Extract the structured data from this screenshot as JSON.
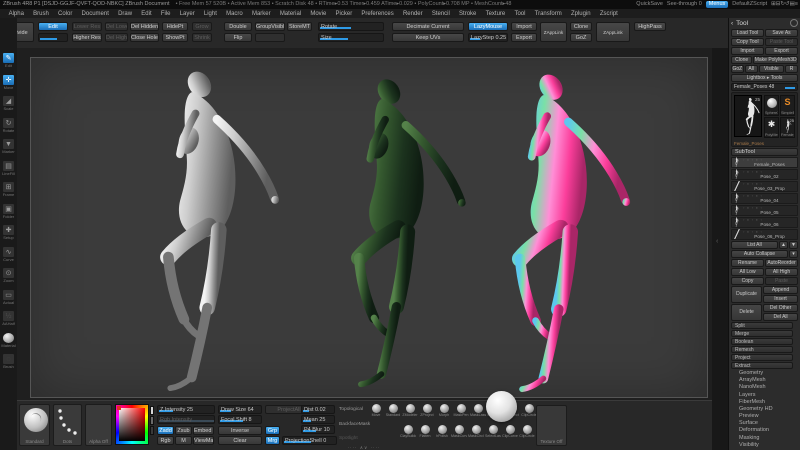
{
  "colors": {
    "accent": "#2e9ae6",
    "canvas_bg": "#3b3b3b",
    "shelf_bg": "#282828",
    "panel_bg": "#2c2c2c",
    "blue_button_top": "#49b0f2",
    "blue_button_bottom": "#1a6db6"
  },
  "titlebar": {
    "title": "ZBrush 4R8 P1 [DSJD-GGJF-QVFT-QOD-NBKC]  ZBrush Document",
    "stats": "• Free Mem 57 520B • Active Mem 853 • Scratch Disk 48 • RTime▸0.53 Timer▸0.459 ATime▸0.029 • PolyCount▸0.708 MP • MeshCount▸48",
    "quicksave": "QuickSave",
    "see_through": "See-through 0",
    "menus": "Menus",
    "zscript": "DefaultZScript",
    "icons": [
      "⊞",
      "⊟",
      "↻",
      "↺",
      "▤",
      "≡"
    ]
  },
  "menubar": {
    "items": [
      "Alpha",
      "Brush",
      "Color",
      "Document",
      "Draw",
      "Edit",
      "File",
      "Layer",
      "Light",
      "Macro",
      "Marker",
      "Material",
      "Movie",
      "Picker",
      "Preferences",
      "Render",
      "Stencil",
      "Stroke",
      "Texture",
      "Tool",
      "Transform",
      "Zplugin",
      "Zscript"
    ]
  },
  "topshelf": {
    "divide": "Divide",
    "edit": "Edit",
    "lower_res": "Lower Res",
    "higher_res": "Higher Res",
    "del_lower": "Del Lower",
    "del_higher": "Del Higher",
    "del_hidden": "Del Hidden",
    "close_holes": "Close Holes",
    "hidept": "HidePt",
    "showpt": "ShowPt",
    "grow": "Grow",
    "shrink": "Shrink",
    "double": "Double",
    "flip": "Flip",
    "group_visible": "GroupVisible",
    "store_mt": "StoreMT",
    "rotate": "Rotate",
    "size": "Size",
    "decimate": "Decimate Current",
    "keep_uvs": "Keep UVs",
    "lazymouse": "LazyMouse",
    "lazystep": "LazyStep 0.25",
    "import": "Import",
    "export": "Export",
    "zapplink": "ZAppLink",
    "clone": "Clone",
    "goz": "GoZ",
    "zapplink2": "ZAppLink",
    "highpass": "HighPass"
  },
  "left_toolbar": {
    "items": [
      {
        "icon": "✎",
        "label": "Edit",
        "state": "active"
      },
      {
        "icon": "✛",
        "label": "Move",
        "state": "active"
      },
      {
        "icon": "◢",
        "label": "Scale",
        "state": ""
      },
      {
        "icon": "↻",
        "label": "Rotate",
        "state": ""
      },
      {
        "icon": "▼",
        "label": "Marker",
        "state": ""
      },
      {
        "icon": "▤",
        "label": "LineFill",
        "state": ""
      },
      {
        "icon": "⊞",
        "label": "Frame",
        "state": ""
      },
      {
        "icon": "▣",
        "label": "Folder",
        "state": ""
      },
      {
        "icon": "✚",
        "label": "Setup",
        "state": ""
      },
      {
        "icon": "∿",
        "label": "Curve",
        "state": ""
      },
      {
        "icon": "⊙",
        "label": "Zoom",
        "state": ""
      },
      {
        "icon": "▭",
        "label": "Actual",
        "state": ""
      },
      {
        "icon": "½",
        "label": "AAHalf",
        "state": "dim"
      },
      {
        "icon": "",
        "label": "Material",
        "state": "mat"
      },
      {
        "icon": "◌",
        "label": "Brush",
        "state": "dim"
      }
    ]
  },
  "canvas": {
    "figures": [
      {
        "name": "shaded-gray-sculpt",
        "stops": [
          "#f4f4f4",
          "#cecece",
          "#949494",
          "#5e5e5e"
        ],
        "shin": "#747474"
      },
      {
        "name": "polyframe-green-sculpt",
        "stops": [
          "#55824a",
          "#35592f",
          "#1c331e",
          "#0f1d12"
        ],
        "shin": ""
      },
      {
        "name": "normal-map-sculpt",
        "stops": [
          "#5cc8ee",
          "#7be0a6",
          "#ff8ed6",
          "#fb3e9b",
          "#a92667"
        ],
        "shin": ""
      }
    ]
  },
  "tool_panel": {
    "header": "Tool",
    "load_tool": "Load Tool",
    "save_as": "Save As",
    "copy_tool": "Copy Tool",
    "paste_tool": "Paste Tool",
    "import": "Import",
    "export": "Export",
    "clone": "Clone",
    "make_polymesh": "Make PolyMesh3D",
    "goz": "GoZ",
    "all": "All",
    "visible": "Visible",
    "r": "R",
    "lightbox": "Lightbox ▸ Tools",
    "active_tool": "Female_Poses 48",
    "big_thumb_label": "Female_Poses",
    "big_thumb_badge": "25",
    "recent": [
      {
        "label": "Sphere3D"
      },
      {
        "label": "SimpleBrush"
      },
      {
        "label": "PolyMesh3D"
      },
      {
        "label": "Female_Poses"
      }
    ],
    "recent_badge": "25",
    "s_logo": "S",
    "star_icon": "✱",
    "subtool_header": "SubTool",
    "subtools": [
      {
        "name": "Female_Poses",
        "thumb": "figure",
        "state": "selected"
      },
      {
        "name": "Pose_02",
        "thumb": "figure",
        "state": ""
      },
      {
        "name": "Pose_03_Prop",
        "thumb": "prop",
        "state": ""
      },
      {
        "name": "Pose_04",
        "thumb": "figure",
        "state": ""
      },
      {
        "name": "Pose_05",
        "thumb": "figure",
        "state": ""
      },
      {
        "name": "Pose_06",
        "thumb": "figure",
        "state": ""
      },
      {
        "name": "Pose_06_Prop",
        "thumb": "prop",
        "state": ""
      }
    ],
    "list_all": "List All",
    "up_icon": "▲",
    "down_icon": "▼",
    "auto_collapse": "Auto Collapse",
    "collapse_icon": "▾",
    "rename": "Rename",
    "autoreorder": "AutoReorder",
    "all_low": "All Low",
    "all_high": "All High",
    "copy": "Copy",
    "paste": "Paste",
    "duplicate": "Duplicate",
    "append": "Append",
    "insert": "Insert",
    "delete": "Delete",
    "del_other": "Del Other",
    "del_all": "Del All",
    "sections": [
      "Split",
      "Merge",
      "Boolean",
      "Remesh",
      "Project",
      "Extract"
    ],
    "subpalettes": [
      "Geometry",
      "ArrayMesh",
      "NanoMesh",
      "Layers",
      "FiberMesh",
      "Geometry HD",
      "Preview",
      "Surface",
      "Deformation",
      "Masking",
      "Visibility"
    ]
  },
  "bottom_shelf": {
    "brush_label": "Standard",
    "stroke_label": "Dots",
    "alpha_label": "Alpha Off",
    "texture_label": "Texture Off",
    "z_intensity": "Z Intensity 25",
    "rgb_intensity": "Rgb Intensity",
    "draw_size": "Draw Size 64",
    "focal_shift": "Focal Shift 8",
    "zadd": "Zadd",
    "zsub": "Zsub",
    "rgb": "Rgb",
    "m": "M",
    "embed": "Embed 8",
    "viewmask": "ViewMask",
    "inverse": "Inverse",
    "clear": "Clear",
    "project_all": "ProjectAll",
    "grp": "Grp",
    "mrg": "Mrg",
    "projection_shell": "ProjectionShell 0",
    "dist": "Dist 0.02",
    "mean": "Mean 25",
    "p4_blur": "P4 Blur 10",
    "topological": "Topological",
    "backface_mask": "BackfaceMask",
    "spotlight": "Spotlight",
    "handle": "···· ∧∨ ····",
    "brushes_row1": [
      "Move",
      "Standard",
      "ZModeler",
      "ZProject",
      "Morph",
      "MaskPen",
      "MaskLasso",
      "SelectRect",
      "ClipRect",
      "ClipCircle"
    ],
    "brushes_row2": [
      "ClayBuildup",
      "Flatten",
      "hPolish",
      "MaskCurve",
      "MaskCircle",
      "SelectLasso",
      "ClipCurve",
      "ClipCircle"
    ]
  }
}
